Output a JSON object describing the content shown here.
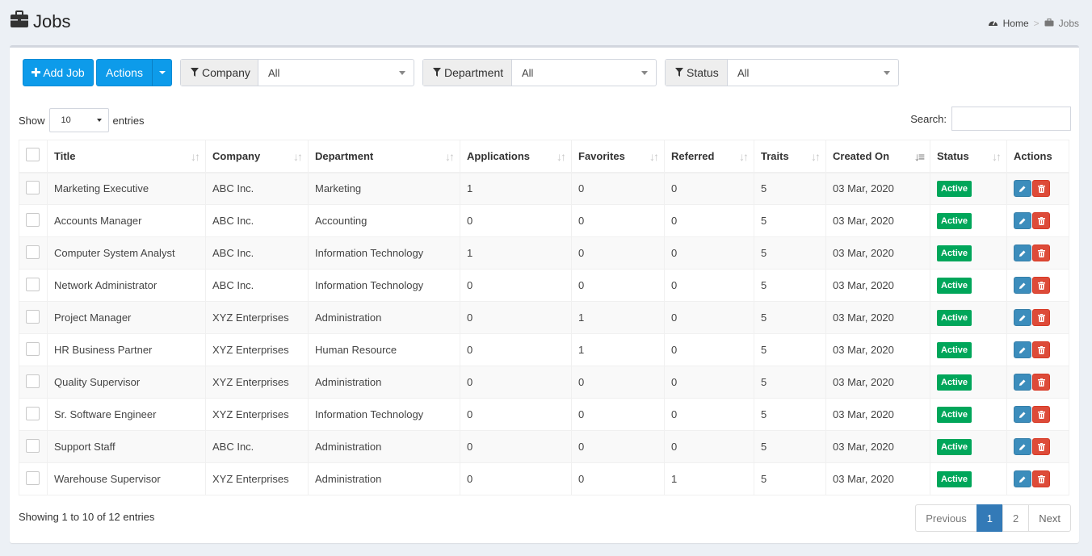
{
  "page": {
    "title": "Jobs"
  },
  "breadcrumb": {
    "home": "Home",
    "current": "Jobs"
  },
  "toolbar": {
    "add_label": "Add Job",
    "actions_label": "Actions"
  },
  "filters": {
    "company": {
      "label": "Company",
      "value": "All"
    },
    "department": {
      "label": "Department",
      "value": "All"
    },
    "status": {
      "label": "Status",
      "value": "All"
    }
  },
  "length": {
    "prefix": "Show",
    "value": "10",
    "suffix": "entries"
  },
  "search": {
    "label": "Search:"
  },
  "table": {
    "headers": [
      "Title",
      "Company",
      "Department",
      "Applications",
      "Favorites",
      "Referred",
      "Traits",
      "Created On",
      "Status",
      "Actions"
    ],
    "rows": [
      {
        "title": "Marketing Executive",
        "company": "ABC Inc.",
        "department": "Marketing",
        "applications": "1",
        "favorites": "0",
        "referred": "0",
        "traits": "5",
        "created": "03 Mar, 2020",
        "status": "Active"
      },
      {
        "title": "Accounts Manager",
        "company": "ABC Inc.",
        "department": "Accounting",
        "applications": "0",
        "favorites": "0",
        "referred": "0",
        "traits": "5",
        "created": "03 Mar, 2020",
        "status": "Active"
      },
      {
        "title": "Computer System Analyst",
        "company": "ABC Inc.",
        "department": "Information Technology",
        "applications": "1",
        "favorites": "0",
        "referred": "0",
        "traits": "5",
        "created": "03 Mar, 2020",
        "status": "Active"
      },
      {
        "title": "Network Administrator",
        "company": "ABC Inc.",
        "department": "Information Technology",
        "applications": "0",
        "favorites": "0",
        "referred": "0",
        "traits": "5",
        "created": "03 Mar, 2020",
        "status": "Active"
      },
      {
        "title": "Project Manager",
        "company": "XYZ Enterprises",
        "department": "Administration",
        "applications": "0",
        "favorites": "1",
        "referred": "0",
        "traits": "5",
        "created": "03 Mar, 2020",
        "status": "Active"
      },
      {
        "title": "HR Business Partner",
        "company": "XYZ Enterprises",
        "department": "Human Resource",
        "applications": "0",
        "favorites": "1",
        "referred": "0",
        "traits": "5",
        "created": "03 Mar, 2020",
        "status": "Active"
      },
      {
        "title": "Quality Supervisor",
        "company": "XYZ Enterprises",
        "department": "Administration",
        "applications": "0",
        "favorites": "0",
        "referred": "0",
        "traits": "5",
        "created": "03 Mar, 2020",
        "status": "Active"
      },
      {
        "title": "Sr. Software Engineer",
        "company": "XYZ Enterprises",
        "department": "Information Technology",
        "applications": "0",
        "favorites": "0",
        "referred": "0",
        "traits": "5",
        "created": "03 Mar, 2020",
        "status": "Active"
      },
      {
        "title": "Support Staff",
        "company": "ABC Inc.",
        "department": "Administration",
        "applications": "0",
        "favorites": "0",
        "referred": "0",
        "traits": "5",
        "created": "03 Mar, 2020",
        "status": "Active"
      },
      {
        "title": "Warehouse Supervisor",
        "company": "XYZ Enterprises",
        "department": "Administration",
        "applications": "0",
        "favorites": "0",
        "referred": "1",
        "traits": "5",
        "created": "03 Mar, 2020",
        "status": "Active"
      }
    ]
  },
  "footer": {
    "info": "Showing 1 to 10 of 12 entries",
    "pagination": {
      "previous": "Previous",
      "pages": [
        "1",
        "2"
      ],
      "current": "1",
      "next": "Next"
    }
  },
  "colors": {
    "primary": "#0d9bea",
    "active_badge": "#00a65a",
    "edit": "#3c8dbc",
    "delete": "#dd4b39",
    "page_current": "#337ab7"
  },
  "icons": {
    "title": "briefcase-icon",
    "home": "dashboard-icon",
    "add": "plus-icon",
    "filter": "filter-icon",
    "edit": "pencil-icon",
    "delete": "trash-icon"
  }
}
